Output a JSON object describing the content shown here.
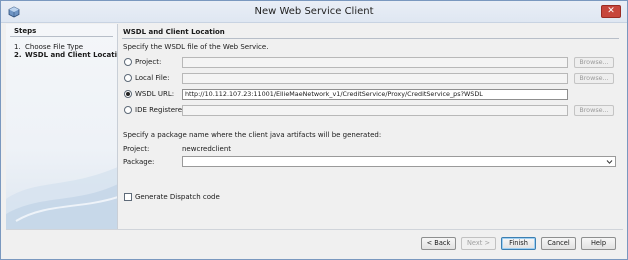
{
  "window": {
    "title": "New Web Service Client"
  },
  "steps": {
    "header": "Steps",
    "items": [
      {
        "num": "1.",
        "label": "Choose File Type"
      },
      {
        "num": "2.",
        "label": "WSDL and Client Location"
      }
    ]
  },
  "panel": {
    "header": "WSDL and Client Location",
    "instruction": "Specify the WSDL file of the Web Service.",
    "options": {
      "project": {
        "label": "Project:",
        "value": ""
      },
      "local_file": {
        "label": "Local File:",
        "value": ""
      },
      "wsdl_url": {
        "label": "WSDL URL:",
        "value": "http://10.112.107.23:11001/EllieMaeNetwork_v1/CreditService/Proxy/CreditService_ps?WSDL"
      },
      "ide_registered": {
        "label": "IDE Registered:",
        "value": ""
      }
    },
    "browse_label": "Browse...",
    "package_instruction": "Specify a package name where the client java artifacts will be generated:",
    "project_label": "Project:",
    "project_value": "newcredclient",
    "package_label": "Package:",
    "package_value": "",
    "dispatch_label": "Generate Dispatch code"
  },
  "buttons": {
    "back": "< Back",
    "next": "Next >",
    "finish": "Finish",
    "cancel": "Cancel",
    "help": "Help"
  },
  "colors": {
    "accent": "#3c7fb1",
    "close": "#c7463b"
  }
}
